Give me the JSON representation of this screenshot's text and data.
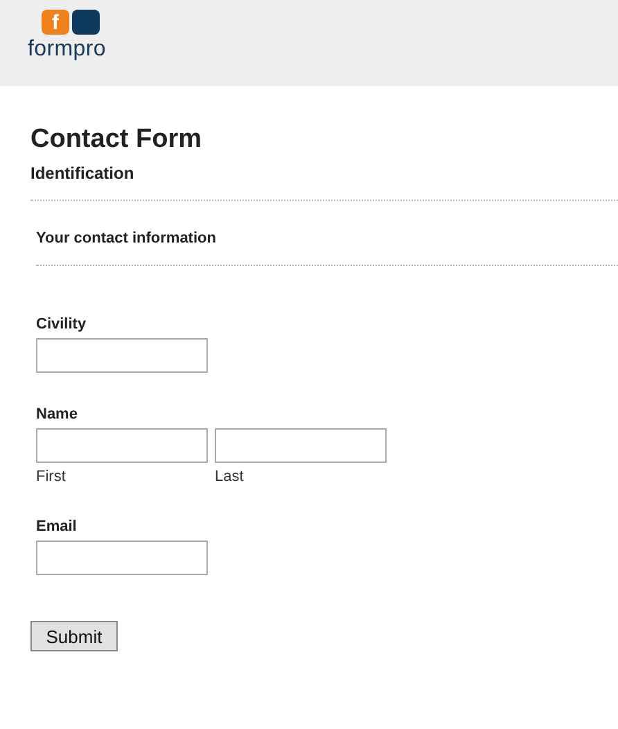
{
  "logo": {
    "mark": "f",
    "name": "formpro"
  },
  "form": {
    "title": "Contact Form",
    "subtitle": "Identification",
    "section": "Your contact information",
    "fields": [
      {
        "kind": "single",
        "label": "Civility"
      },
      {
        "kind": "split",
        "label": "Name",
        "parts": [
          "First",
          "Last"
        ]
      },
      {
        "kind": "single",
        "label": "Email"
      }
    ],
    "submit": "Submit"
  }
}
